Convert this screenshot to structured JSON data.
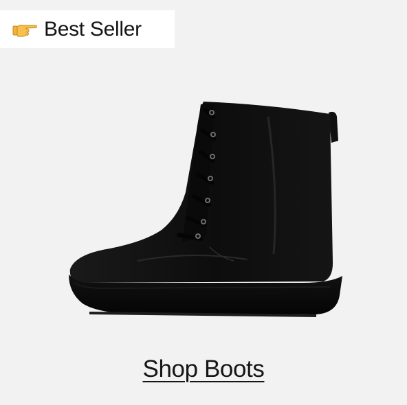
{
  "badge": {
    "label": "Best Seller",
    "icon": "pointing-hand-icon",
    "background_color": "#ffffff"
  },
  "product": {
    "image_icon": "black-lace-up-boot"
  },
  "cta": {
    "label": "Shop Boots"
  },
  "colors": {
    "card_background": "#f2f2f2",
    "text": "#161616",
    "boot": "#0f0f0f",
    "emoji_hand": "#f2b33d"
  }
}
